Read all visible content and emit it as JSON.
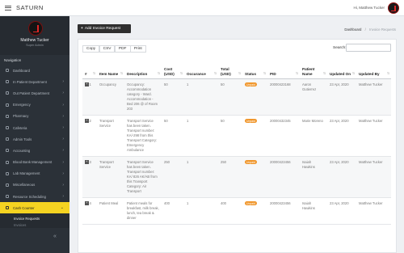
{
  "app": {
    "title": "SATURN"
  },
  "topbar": {
    "user_greeting": "Hi, Matthew Tucker"
  },
  "profile": {
    "name": "Matthew Tucker",
    "role": "Super Admin"
  },
  "sidebar": {
    "section_title": "Navigation",
    "items": [
      {
        "label": "Dashboard",
        "chevron": ""
      },
      {
        "label": "In Patient Department",
        "chevron": "›"
      },
      {
        "label": "Out Patient Department",
        "chevron": "›"
      },
      {
        "label": "Emergency",
        "chevron": "›"
      },
      {
        "label": "Pharmacy",
        "chevron": "›"
      },
      {
        "label": "Cafeteria",
        "chevron": "›"
      },
      {
        "label": "Admin Tools",
        "chevron": "›"
      },
      {
        "label": "Accounting",
        "chevron": "›"
      },
      {
        "label": "Blood Bank Management",
        "chevron": "›"
      },
      {
        "label": "Lab Management",
        "chevron": "›"
      },
      {
        "label": "Miscellaneous",
        "chevron": "›"
      },
      {
        "label": "Resource Scheduling",
        "chevron": "›"
      },
      {
        "label": "Cash Counter",
        "chevron": "⌄"
      }
    ],
    "subitems": [
      {
        "label": "Invoice Requests"
      },
      {
        "label": "Invoices"
      }
    ],
    "collapse_icon": "«"
  },
  "toolbar": {
    "add_button_label": "Add Invoice Request",
    "add_button_icon": "+"
  },
  "breadcrumb": {
    "home": "Dashboard",
    "separator": "/",
    "current": "Invoice Requests"
  },
  "export_buttons": [
    "Copy",
    "CSV",
    "PDF",
    "Print"
  ],
  "search": {
    "label": "Search:",
    "value": ""
  },
  "table": {
    "headers": [
      "#",
      "Item Name",
      "Description",
      "Cost (USD)",
      "Occurance",
      "Total (USD)",
      "Status",
      "PID",
      "Patient Name",
      "Updated On",
      "Updated By"
    ],
    "sort_glyph": "⇅",
    "expand_glyph": "+",
    "rows": [
      {
        "num": "1",
        "item": "Occupancy",
        "description": "Occupancy: Accommodation category - Ward. Accommodation - Bed 206 @ of Room 203",
        "cost": "50",
        "occurance": "1",
        "total": "50",
        "status": "Unpaid",
        "pid": "20000423168",
        "patient": "Aaron Gutierrez",
        "updated_on": "23 Apr, 2020",
        "updated_by": "Matthew Tucker"
      },
      {
        "num": "2",
        "item": "Transport Service",
        "description": "Transport Service has been taken. Transport number: KA/-298 from this Transport Category: Emergency Ambulance",
        "cost": "50",
        "occurance": "1",
        "total": "50",
        "status": "Unpaid",
        "pid": "20000432345",
        "patient": "Marie Moreno",
        "updated_on": "23 Apr, 2020",
        "updated_by": "Matthew Tucker"
      },
      {
        "num": "3",
        "item": "Transport Service",
        "description": "Transport Service has been taken. Transport number: KA/ 826 AK/AB from this Transport Category: Air Transport",
        "cost": "250",
        "occurance": "1",
        "total": "250",
        "status": "Unpaid",
        "pid": "20000423456",
        "patient": "Isaiah Hawkins",
        "updated_on": "23 Apr, 2020",
        "updated_by": "Matthew Tucker"
      },
      {
        "num": "4",
        "item": "Patient Meal",
        "description": "Patient meals for breakfast, milk break, lunch, tea break & dinner",
        "cost": "400",
        "occurance": "1",
        "total": "400",
        "status": "Unpaid",
        "pid": "20000423456",
        "patient": "Isaiah Hawkins",
        "updated_on": "23 Apr, 2020",
        "updated_by": "Matthew Tucker"
      }
    ]
  },
  "colors": {
    "sidebar_bg": "#2b3138",
    "active_item": "#f5d321",
    "status_unpaid": "#f0962b",
    "button_dark": "#2f2f2f",
    "logo_red": "#e02525"
  }
}
